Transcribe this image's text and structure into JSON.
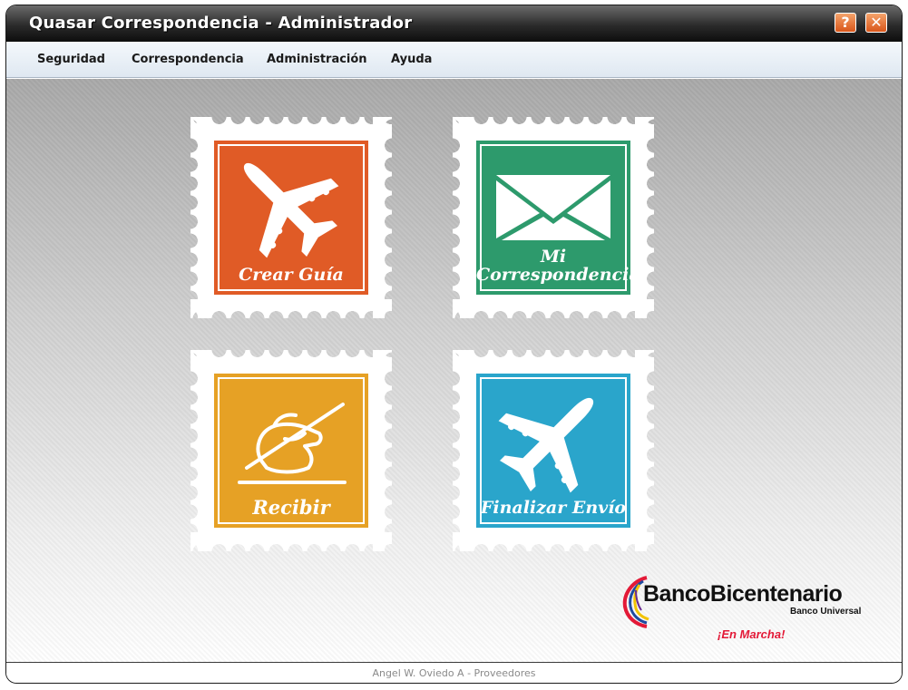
{
  "window": {
    "title": "Quasar Correspondencia - Administrador"
  },
  "title_buttons": {
    "help": "?",
    "close": "✕"
  },
  "menu": [
    {
      "label": "Seguridad"
    },
    {
      "label": "Correspondencia"
    },
    {
      "label": "Administración"
    },
    {
      "label": "Ayuda"
    }
  ],
  "stamps": [
    {
      "label": "Crear Guía",
      "color": "#e05b26",
      "icon": "airplane-icon"
    },
    {
      "label_line1": "Mi",
      "label_line2": "Correspondencia",
      "color": "#2d9a6c",
      "icon": "envelope-icon"
    },
    {
      "label": "Recibir",
      "color": "#e6a125",
      "icon": "writing-hand-icon"
    },
    {
      "label": "Finalizar Envío",
      "color": "#2aa5cb",
      "icon": "airplane-icon"
    }
  ],
  "logo": {
    "name": "BancoBicentenario",
    "subtitle": "Banco Universal",
    "slogan": "¡En Marcha!"
  },
  "status": {
    "text": "Angel W. Oviedo A - Proveedores"
  },
  "colors": {
    "accent": "#e05b26",
    "logo_red": "#e31937"
  }
}
